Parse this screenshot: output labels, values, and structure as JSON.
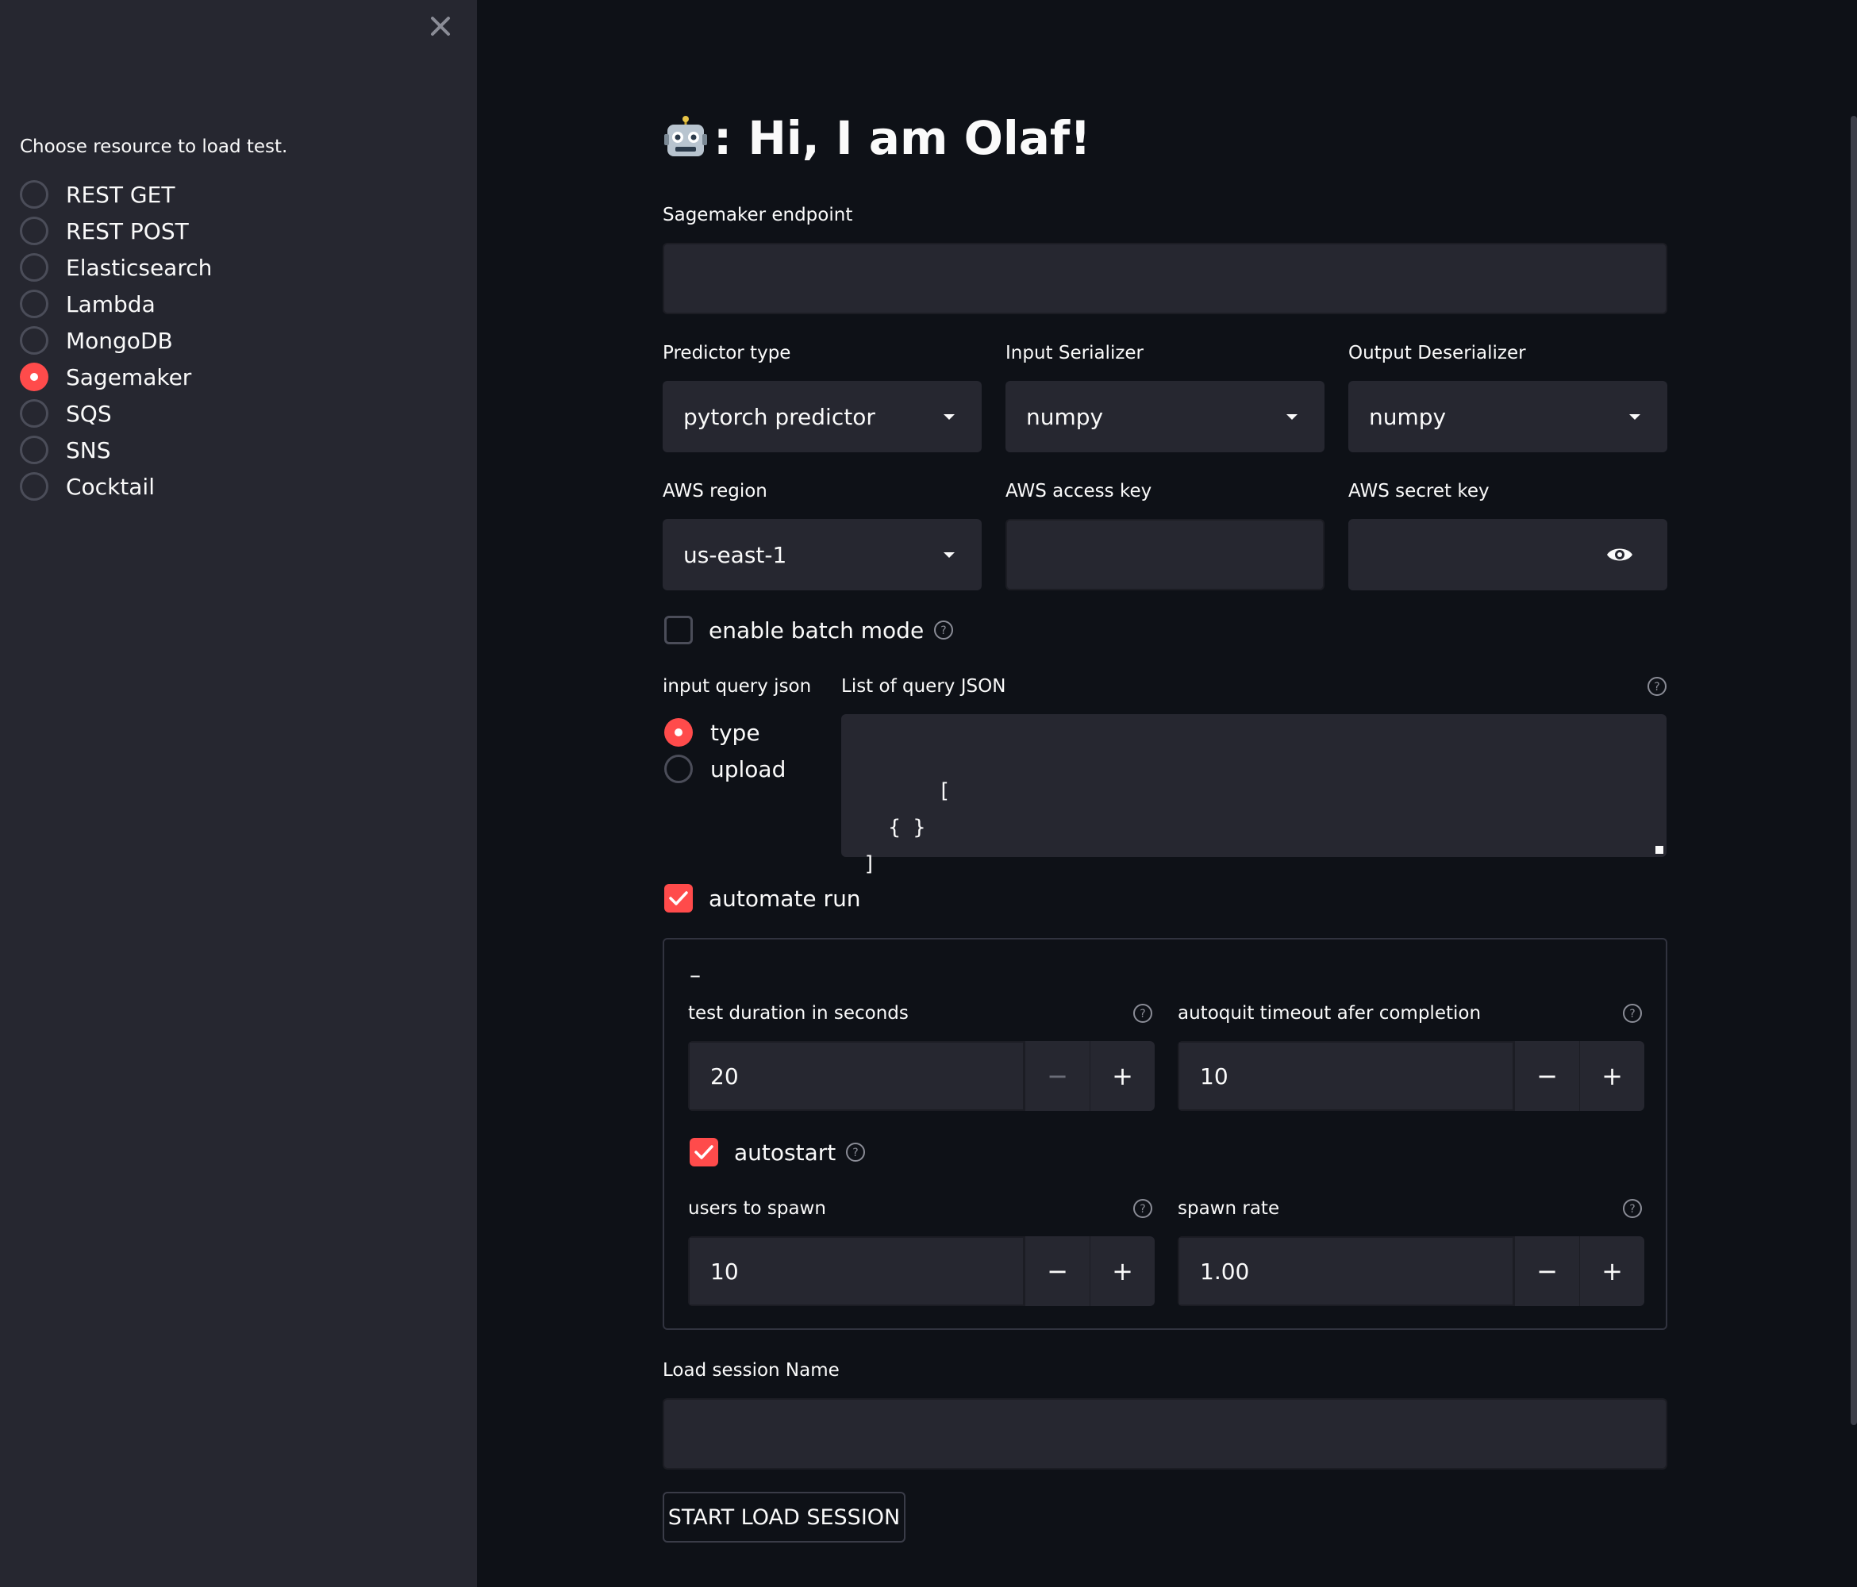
{
  "sidebar": {
    "label": "Choose resource to load test.",
    "options": [
      "REST GET",
      "REST POST",
      "Elasticsearch",
      "Lambda",
      "MongoDB",
      "Sagemaker",
      "SQS",
      "SNS",
      "Cocktail"
    ],
    "selected": "Sagemaker"
  },
  "main": {
    "title": ": Hi, I am Olaf!",
    "endpoint_label": "Sagemaker endpoint",
    "endpoint_value": "",
    "predictor_label": "Predictor type",
    "predictor_value": "pytorch predictor",
    "serializer_label": "Input Serializer",
    "serializer_value": "numpy",
    "deserializer_label": "Output Deserializer",
    "deserializer_value": "numpy",
    "region_label": "AWS region",
    "region_value": "us-east-1",
    "access_key_label": "AWS access key",
    "secret_key_label": "AWS secret key",
    "batch_mode_label": "enable batch mode",
    "query_input_label": "input query json",
    "query_input_options": [
      "type",
      "upload"
    ],
    "query_input_selected": "type",
    "query_json_label": "List of query JSON",
    "query_json_value": "[\n  { }\n]",
    "automate_label": "automate run",
    "expander_toggle": "–",
    "duration_label": "test duration in seconds",
    "duration_value": "20",
    "autoquit_label": "autoquit timeout afer completion",
    "autoquit_value": "10",
    "autostart_label": "autostart",
    "users_label": "users to spawn",
    "users_value": "10",
    "spawn_rate_label": "spawn rate",
    "spawn_rate_value": "1.00",
    "session_name_label": "Load session Name",
    "submit_label": "START LOAD SESSION",
    "minus": "−",
    "plus": "+"
  },
  "colors": {
    "accent": "#ff4b4b",
    "background": "#0e1117",
    "sidebar": "#262730",
    "input": "#262730"
  }
}
